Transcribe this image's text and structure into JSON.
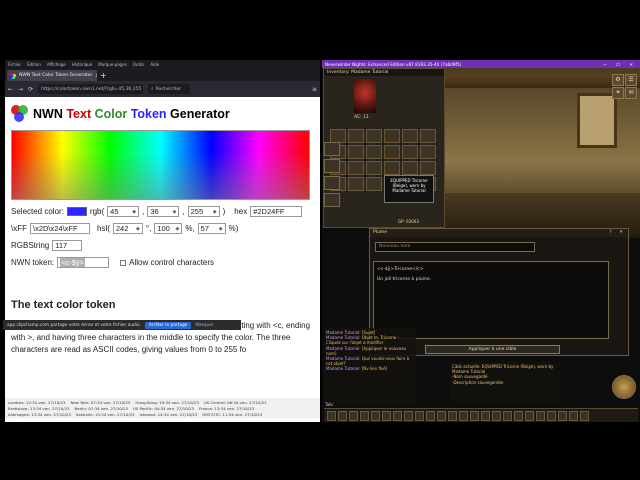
{
  "browser": {
    "menu": [
      "Fichier",
      "Édition",
      "Affichage",
      "Historique",
      "Marque-pages",
      "Outils",
      "Aide"
    ],
    "tab_title": "NWN Text Color Token Generator",
    "tab_close": "×",
    "new_tab": "+",
    "url": "https://colortoken.nwn1.net/?rgb=45,36,255",
    "search_placeholder": "Rechercher",
    "icons": {
      "back": "←",
      "forward": "→",
      "reload": "⟳",
      "search": "⌕",
      "menu": "≡"
    }
  },
  "page": {
    "title_parts": [
      {
        "text": "NWN ",
        "color": "#000000"
      },
      {
        "text": "Text ",
        "color": "#cc0000"
      },
      {
        "text": "Color ",
        "color": "#2d8a2d"
      },
      {
        "text": "Token ",
        "color": "#2d24ff"
      },
      {
        "text": "Generator",
        "color": "#000000"
      }
    ],
    "selected_color_label": "Selected color:",
    "selected_color_hex": "#2D24FF",
    "rgb_label": "rgb(",
    "r": "45",
    "g": "36",
    "b": "255",
    "rgb_close": ")",
    "hex_label": "hex",
    "hex_value": "#2D24FF",
    "escape_prefix": "\\xFF",
    "escape_value": "\\x2D\\x24\\xFF",
    "hsl_label": "hsl(",
    "h": "242",
    "s": "100",
    "l": "57",
    "deg_sep": "°,",
    "pct_sep": "%,",
    "pct_close": "%)",
    "rgbstring_label": "RGBString",
    "rgbstring_value": "117",
    "token_label": "NWN token:",
    "token_value": "<c-$ÿ>",
    "control_chars_label": "Allow control characters",
    "section_title": "The text color token",
    "paragraph": "The token that begins colored text is a 6-character sequence starting with <c, ending with >, and having three characters in the middle to specify the color. The three characters are read as ASCII codes, giving values from 0 to 255 fo"
  },
  "share_bar": {
    "text": "app.clipchamp.com partage votre écran et votre fichier audio.",
    "button_primary": "Arrêter le partage",
    "button_secondary": "Masquer"
  },
  "clocks": [
    "Londres: 12:34 ven. 27/10/23",
    "New York: 07:34 ven. 27/10/23",
    "Hong-Kong: 19:34 ven. 27/10/23",
    "US Central: 06:34 ven. 27/10/23",
    "Bratislava: 13:34 ven. 27/10/23",
    "Berlin: 07:34 ven. 27/10/23",
    "US Pacific: 04:34 ven. 27/10/23",
    "France: 13:34 ven. 27/10/23",
    "Allemagne: 13:34 ven. 27/10/23",
    "Sakhalin: 13:34 ven. 27/10/23",
    "Istanbul: 14:34 ven. 27/10/23",
    "GMT/UTC: 11:34 ven. 27/10/23"
  ],
  "game": {
    "window_title": "Neverwinter Nights: Enhanced Edition v87.8193.35-40 (7a6d9f5)",
    "window_buttons": "— ☐ ✕",
    "inventory_title": "Inventory: Madame Tutorial",
    "ac": "AC: 11",
    "gp": "GP: 93003",
    "tooltip": "EQUIPPED Tricorne (Beige), worn by Madame Tutorial",
    "plume": {
      "title": "Plume",
      "title_buttons": "? ✕",
      "name_placeholder": "Nouveau nom",
      "body_line1": "<c-$ÿ>Tricorne</c>",
      "body_line2": "Un joli tricorne à plume.",
      "apply_label": "Appliquer à une cible"
    },
    "chat_left": [
      {
        "name": "Madame Tutorial:",
        "text": "[Sujet]"
      },
      {
        "name": "Madame Tutorial:",
        "text": "Objet m. Tricorne - Cliquez sur l'objet à modifier"
      },
      {
        "name": "Madame Tutorial:",
        "text": "[Appliquer le nouveau nom]"
      },
      {
        "name": "Madame Tutorial:",
        "text": "Que voulez-vous faire à cet objet?"
      },
      {
        "name": "Madame Tutorial:",
        "text": "[Nv lien fixé]"
      }
    ],
    "chat_right": [
      "Cible actuelle: EQUIPPED Tricorne (Beige), worn by Madame Tutorial",
      "-Nom sauvegardé",
      "-Description sauvegardée"
    ],
    "talk_label": "Talk:",
    "side_buttons": [
      "⚙",
      "☰",
      "✦",
      "✉"
    ]
  }
}
